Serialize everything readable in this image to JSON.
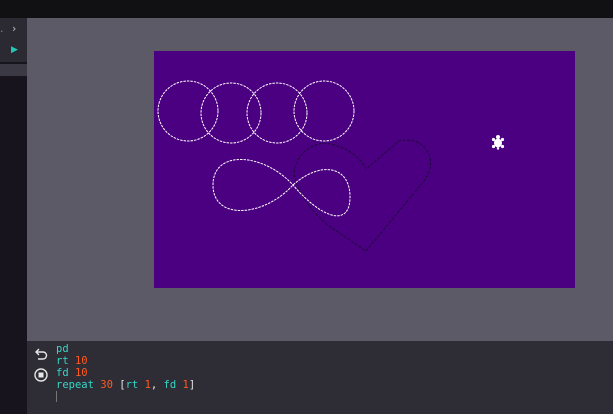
{
  "sidebar": {
    "chevron_icon": "chevron-right-icon",
    "run_icon": "play-icon"
  },
  "editor": {
    "undo_icon": "undo-icon",
    "stop_icon": "stop-icon",
    "lines": [
      [
        {
          "t": "pd",
          "c": "kw"
        }
      ],
      [
        {
          "t": "rt",
          "c": "kw"
        },
        {
          "t": " ",
          "c": "plain"
        },
        {
          "t": "10",
          "c": "num"
        }
      ],
      [
        {
          "t": "fd",
          "c": "kw"
        },
        {
          "t": " ",
          "c": "plain"
        },
        {
          "t": "10",
          "c": "num"
        }
      ],
      [
        {
          "t": "repeat",
          "c": "kw"
        },
        {
          "t": " ",
          "c": "plain"
        },
        {
          "t": "30",
          "c": "num"
        },
        {
          "t": " [",
          "c": "plain"
        },
        {
          "t": "rt",
          "c": "kw"
        },
        {
          "t": " ",
          "c": "plain"
        },
        {
          "t": "1",
          "c": "num"
        },
        {
          "t": ", ",
          "c": "plain"
        },
        {
          "t": "fd",
          "c": "kw"
        },
        {
          "t": " ",
          "c": "plain"
        },
        {
          "t": "1",
          "c": "num"
        },
        {
          "t": "]",
          "c": "plain"
        }
      ]
    ]
  },
  "canvas": {
    "background": "#4b0082",
    "pen_white": "#ffffff",
    "pen_dark": "#1e0a3c",
    "turtle_icon": "turtle-icon"
  }
}
